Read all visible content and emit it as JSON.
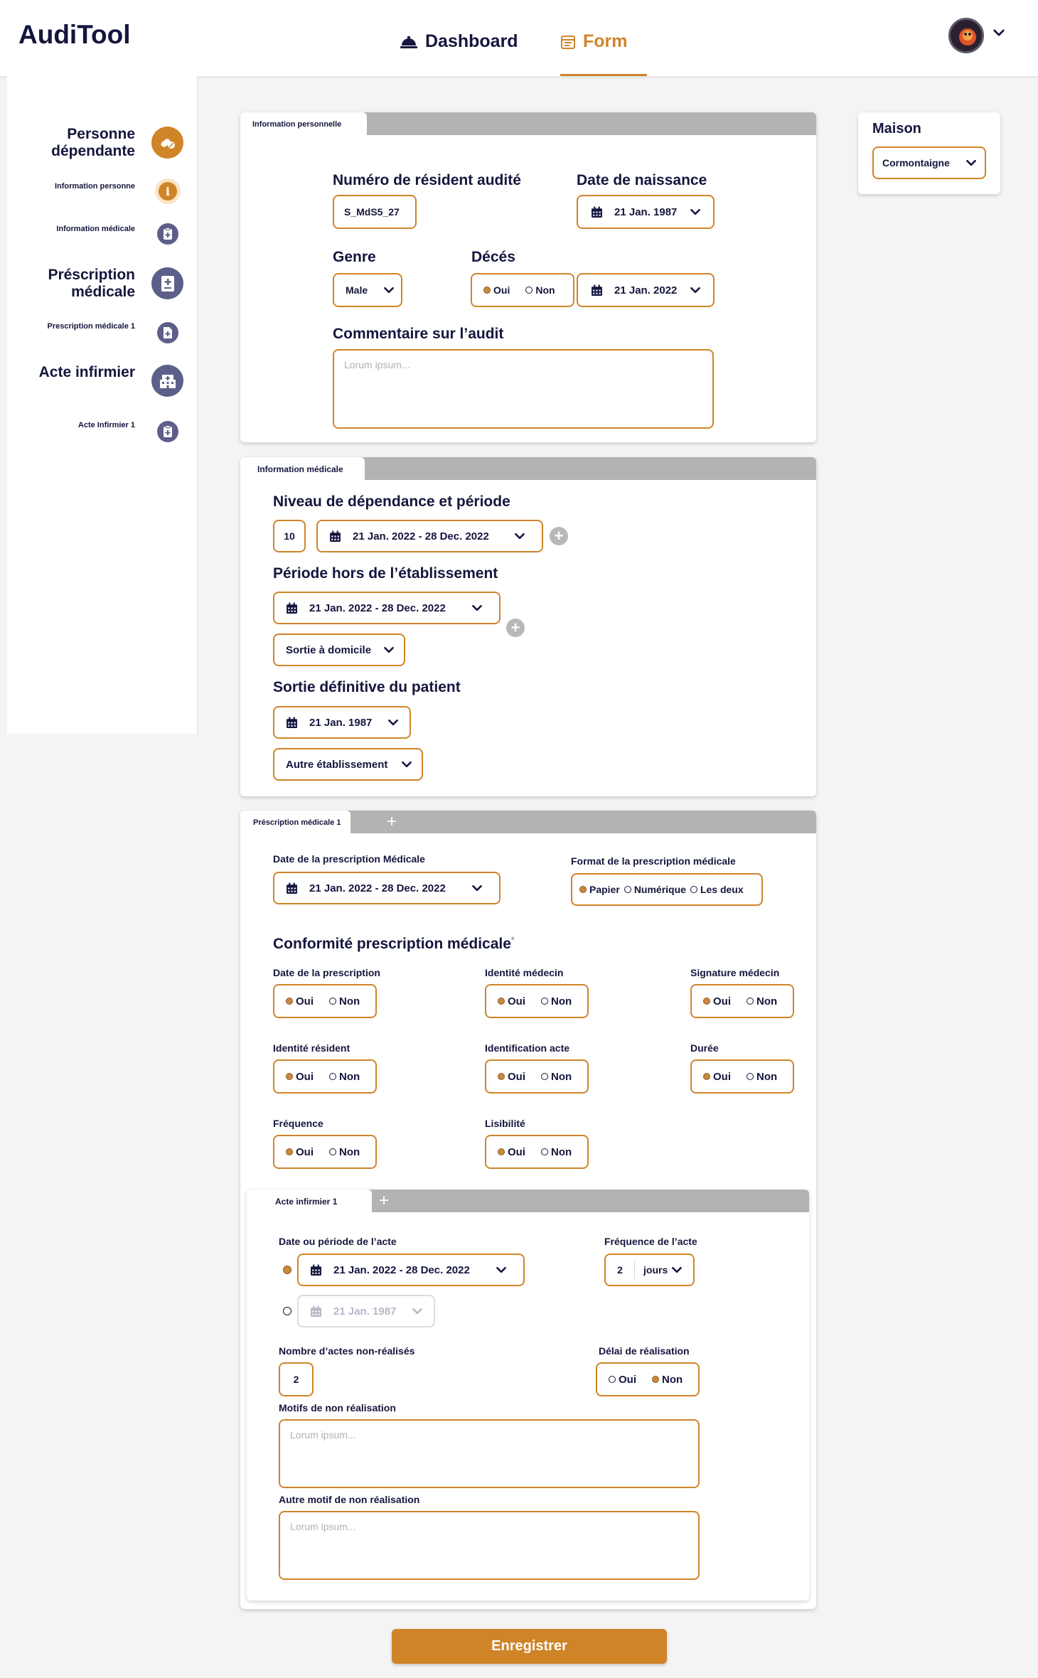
{
  "app": {
    "logo": "AudiTool"
  },
  "nav": {
    "dashboard": "Dashboard",
    "form": "Form"
  },
  "sidebar": {
    "items": [
      {
        "label": "Personne dépendante",
        "icon": "pills-icon"
      },
      {
        "label": "Information personne",
        "icon": "info-icon"
      },
      {
        "label": "Information médicale",
        "icon": "medical-clipboard-icon"
      },
      {
        "label": "Préscription médicale",
        "icon": "medical-report-icon"
      },
      {
        "label": "Prescription médicale 1",
        "icon": "document-icon"
      },
      {
        "label": "Acte infirmier",
        "icon": "hospital-icon"
      },
      {
        "label": "Acte Infirmier 1",
        "icon": "medical-clipboard-icon"
      }
    ]
  },
  "maison": {
    "title": "Maison",
    "value": "Cormontaigne"
  },
  "personal": {
    "tab": "Information personnelle",
    "resident_label": "Numéro de résident audité",
    "resident_value": "S_MdS5_27",
    "birth_label": "Date de naissance",
    "birth_value": "21 Jan. 1987",
    "genre_label": "Genre",
    "genre_value": "Male",
    "deces_label": "Décés",
    "oui": "Oui",
    "non": "Non",
    "deces_date": "21 Jan. 2022",
    "comment_label": "Commentaire sur l’audit",
    "comment_placeholder": "Lorum ipsum..."
  },
  "medical": {
    "tab": "Information médicale",
    "dependance_label": "Niveau de dépendance et période",
    "dependance_value": "10",
    "dependance_period": "21 Jan. 2022 - 28 Dec. 2022",
    "hors_label": "Période hors de l’établissement",
    "hors_period": "21 Jan. 2022 - 28 Dec. 2022",
    "hors_reason": "Sortie à domicile",
    "sortie_label": "Sortie définitive du patient",
    "sortie_date": "21 Jan. 1987",
    "sortie_dest": "Autre établissement"
  },
  "prescription": {
    "tab": "Préscription médicale 1",
    "date_label": "Date de la prescription Médicale",
    "date_value": "21 Jan. 2022 - 28 Dec. 2022",
    "format_label": "Format de la prescription médicale",
    "format_options": [
      "Papier",
      "Numérique",
      "Les deux"
    ],
    "conformite_title": "Conformité prescription médicale",
    "conformite_star": "*",
    "checks": [
      {
        "label": "Date de la prescription"
      },
      {
        "label": "Identité médecin"
      },
      {
        "label": "Signature médecin"
      },
      {
        "label": "Identité résident"
      },
      {
        "label": "Identification acte"
      },
      {
        "label": "Durée"
      },
      {
        "label": "Fréquence"
      },
      {
        "label": "Lisibilité"
      }
    ],
    "oui": "Oui",
    "non": "Non"
  },
  "acte": {
    "tab": "Acte infirmier 1",
    "periode_label": "Date ou période de l’acte",
    "periode_value": "21 Jan. 2022 - 28 Dec. 2022",
    "date_single": "21 Jan. 1987",
    "freq_label": "Fréquence de l’acte",
    "freq_value": "2",
    "freq_unit": "jours",
    "nonreal_label": "Nombre d’actes non-réalisés",
    "nonreal_value": "2",
    "delai_label": "Délai de réalisation",
    "oui": "Oui",
    "non": "Non",
    "motifs_label": "Motifs de non réalisation",
    "motifs_placeholder": "Lorum ipsum...",
    "autre_label": "Autre motif de non réalisation",
    "autre_placeholder": "Lorum ipsum..."
  },
  "save": "Enregistrer",
  "colors": {
    "accent": "#d08428",
    "navy": "#14163d",
    "icon_muted": "#5d5f8a",
    "tab_gray": "#b3b3b3"
  }
}
